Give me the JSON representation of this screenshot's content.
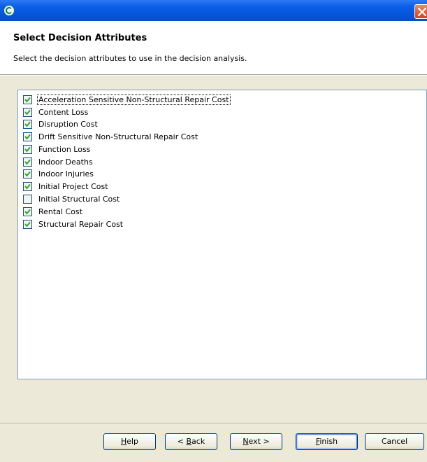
{
  "window": {
    "app_icon": "app-logo-icon",
    "close_icon": "close-icon"
  },
  "header": {
    "title": "Select Decision Attributes",
    "description": "Select the decision attributes to use in the decision analysis."
  },
  "attributes": [
    {
      "label": "Acceleration Sensitive Non-Structural Repair Cost",
      "checked": true
    },
    {
      "label": "Content Loss",
      "checked": true
    },
    {
      "label": "Disruption Cost",
      "checked": true
    },
    {
      "label": "Drift Sensitive Non-Structural Repair Cost",
      "checked": true
    },
    {
      "label": "Function Loss",
      "checked": true
    },
    {
      "label": "Indoor Deaths",
      "checked": true
    },
    {
      "label": "Indoor Injuries",
      "checked": true
    },
    {
      "label": "Initial Project Cost",
      "checked": true
    },
    {
      "label": "Initial Structural Cost",
      "checked": false
    },
    {
      "label": "Rental Cost",
      "checked": true
    },
    {
      "label": "Structural Repair Cost",
      "checked": true
    }
  ],
  "buttons": {
    "help": {
      "mnemonic": "H",
      "rest": "elp"
    },
    "back": {
      "pre": "< ",
      "mnemonic": "B",
      "rest": "ack"
    },
    "next": {
      "mnemonic": "N",
      "rest": "ext >"
    },
    "finish": {
      "mnemonic": "F",
      "rest": "inish"
    },
    "cancel": {
      "label": "Cancel"
    }
  },
  "colors": {
    "titlebar": "#0a5ce6",
    "checkmark": "#21a121",
    "dialog_bg": "#ece9d8"
  }
}
